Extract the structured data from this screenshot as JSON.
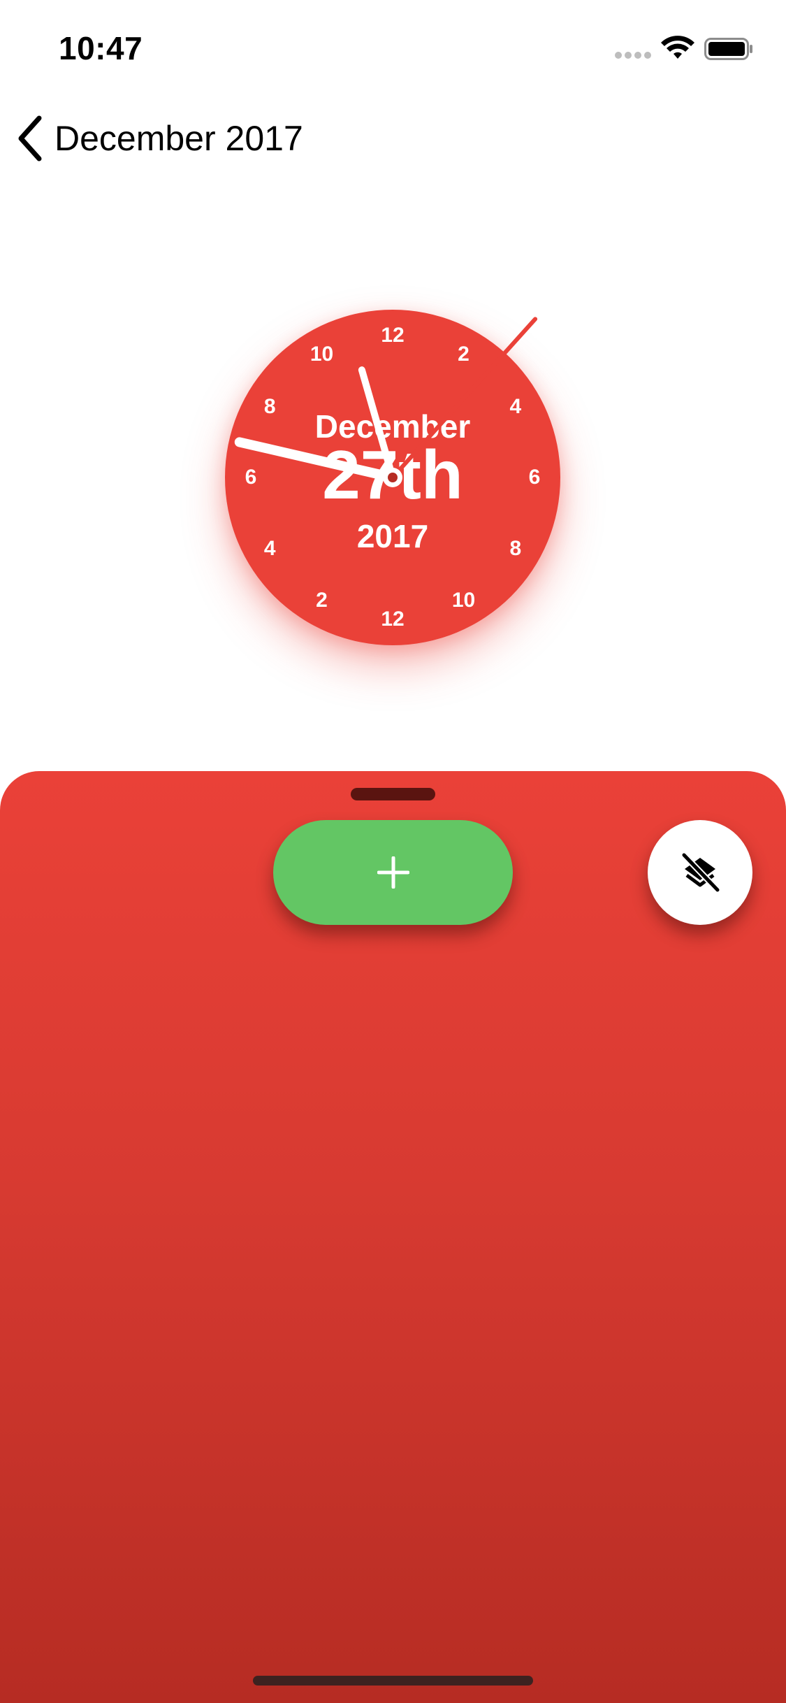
{
  "status_bar": {
    "time": "10:47",
    "icons": [
      "cellular-signal-icon",
      "wifi-icon",
      "battery-icon"
    ]
  },
  "nav": {
    "back_icon": "chevron-left-icon",
    "title": "December 2017"
  },
  "clock": {
    "numbers": [
      "12",
      "2",
      "4",
      "6",
      "8",
      "10",
      "12",
      "2",
      "4",
      "6",
      "8",
      "10"
    ],
    "month": "December",
    "day": "27th",
    "year": "2017",
    "hands": {
      "hour_hand_degrees": 344,
      "minute_hand_degrees": 283,
      "second_hand_degrees": 42
    },
    "colors": {
      "face": "#ea4138",
      "hands": "#ffffff",
      "second_hand": "#ea4138"
    }
  },
  "bottom_sheet": {
    "add_button_icon": "plus-icon",
    "layers_button_icon": "layers-off-icon",
    "colors": {
      "top": "#ea4138",
      "bottom": "#b62c23",
      "add_button": "#63c664",
      "layers_button": "#ffffff"
    }
  }
}
